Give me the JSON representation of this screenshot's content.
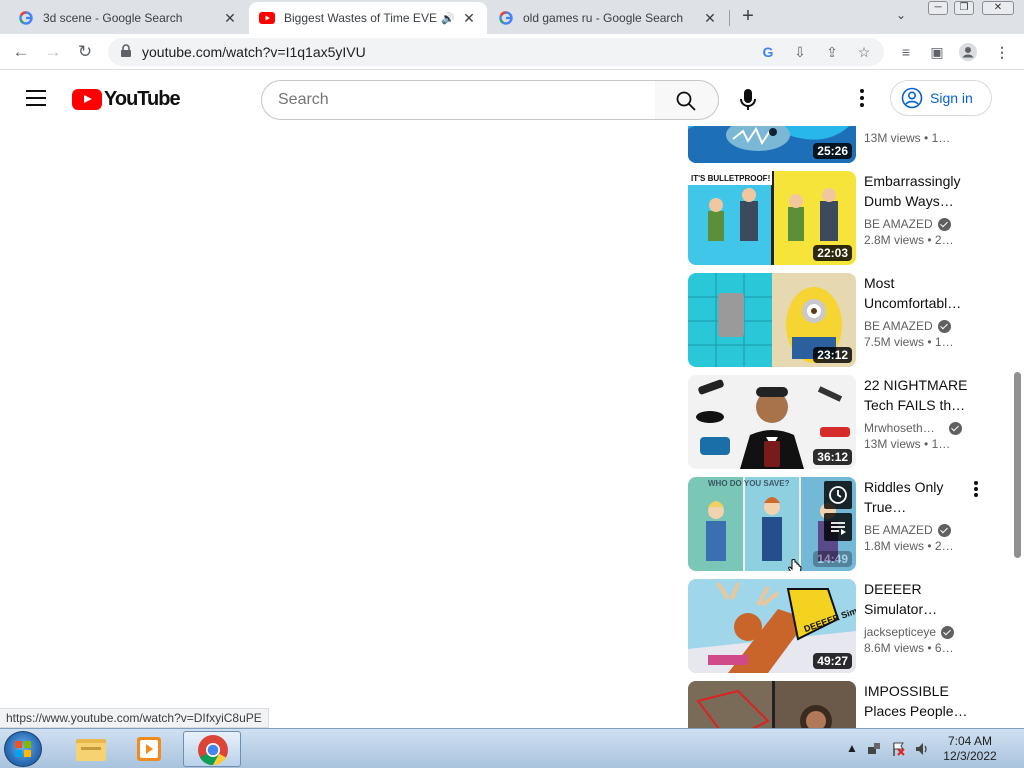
{
  "browser": {
    "tabs": [
      {
        "title": "3d scene - Google Search",
        "favicon": "google-icon",
        "active": false
      },
      {
        "title": "Biggest Wastes of Time EVER",
        "favicon": "youtube-icon",
        "active": true,
        "audio": true
      },
      {
        "title": "old games ru - Google Search",
        "favicon": "google-icon",
        "active": false
      }
    ],
    "url": "youtube.com/watch?v=I1q1ax5yIVU",
    "status_link": "https://www.youtube.com/watch?v=DIfxyiC8uPE"
  },
  "youtube": {
    "logo_text": "YouTube",
    "search_placeholder": "Search",
    "sign_in_label": "Sign in"
  },
  "recommendations": [
    {
      "title": "",
      "channel": "",
      "views": "13M views",
      "age": "1…",
      "duration": "25:26",
      "verified": false
    },
    {
      "title": "Embarrassingly Dumb Ways…",
      "channel": "BE AMAZED",
      "views": "2.8M views",
      "age": "2…",
      "duration": "22:03",
      "verified": true,
      "thumb_caption": "IT'S BULLETPROOF!"
    },
    {
      "title": "Most Uncomfortabl…",
      "channel": "BE AMAZED",
      "views": "7.5M views",
      "age": "1…",
      "duration": "23:12",
      "verified": true
    },
    {
      "title": "22 NIGHTMARE Tech FAILS th…",
      "channel": "Mrwhoseth…",
      "views": "13M views",
      "age": "1…",
      "duration": "36:12",
      "verified": true
    },
    {
      "title": "Riddles Only True…",
      "channel": "BE AMAZED",
      "views": "1.8M views",
      "age": "2…",
      "duration": "14:49",
      "verified": true,
      "thumb_caption": "WHO DO YOU SAVE?",
      "hovered": true
    },
    {
      "title": "DEEEER Simulator…",
      "channel": "jacksepticeye",
      "views": "8.6M views",
      "age": "6…",
      "duration": "49:27",
      "verified": true,
      "thumb_caption": "DEEEER Simulator"
    },
    {
      "title": "IMPOSSIBLE Places People…",
      "channel": "",
      "views": "",
      "age": "",
      "duration": "",
      "verified": false
    }
  ],
  "taskbar": {
    "time": "7:04 AM",
    "date": "12/3/2022"
  }
}
